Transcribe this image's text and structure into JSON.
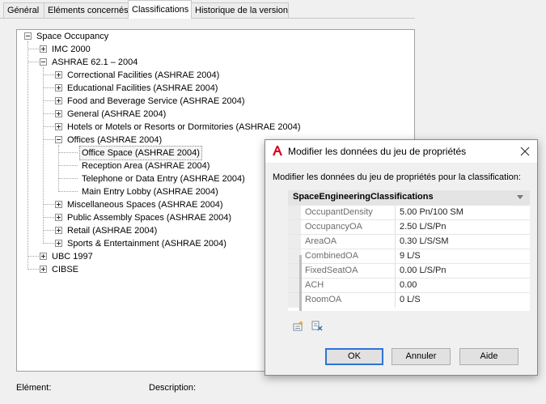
{
  "tabs": [
    {
      "label": "Général"
    },
    {
      "label": "Eléments concernés"
    },
    {
      "label": "Classifications"
    },
    {
      "label": "Historique de la version"
    }
  ],
  "tree": {
    "root": "Space Occupancy",
    "imc": "IMC 2000",
    "ashrae": "ASHRAE 62.1 – 2004",
    "correctional": "Correctional Facilities (ASHRAE 2004)",
    "educational": "Educational Facilities (ASHRAE 2004)",
    "food": "Food and Beverage Service (ASHRAE 2004)",
    "general": "General (ASHRAE 2004)",
    "hotels": "Hotels or Motels or Resorts or Dormitories (ASHRAE 2004)",
    "offices": "Offices (ASHRAE 2004)",
    "office_space": "Office Space (ASHRAE 2004)",
    "reception": "Reception Area (ASHRAE 2004)",
    "telephone": "Telephone or Data Entry (ASHRAE 2004)",
    "lobby": "Main Entry Lobby (ASHRAE 2004)",
    "misc": "Miscellaneous Spaces (ASHRAE 2004)",
    "public": "Public Assembly Spaces (ASHRAE 2004)",
    "retail": "Retail (ASHRAE 2004)",
    "sports": "Sports & Entertainment (ASHRAE 2004)",
    "ubc": "UBC 1997",
    "cibse": "CIBSE"
  },
  "bottom": {
    "element_label": "Elément:",
    "description_label": "Description:"
  },
  "dialog": {
    "title": "Modifier les données du jeu de propriétés",
    "subtitle": "Modifier les données du jeu de propriétés pour la classification:",
    "group_name": "SpaceEngineeringClassifications",
    "properties": [
      {
        "name": "OccupantDensity",
        "value": "5.00 Pn/100 SM"
      },
      {
        "name": "OccupancyOA",
        "value": "2.50  L/S/Pn"
      },
      {
        "name": "AreaOA",
        "value": "0.30 L/S/SM"
      },
      {
        "name": "CombinedOA",
        "value": "9 L/S"
      },
      {
        "name": "FixedSeatOA",
        "value": "0.00  L/S/Pn"
      },
      {
        "name": "ACH",
        "value": "0.00"
      },
      {
        "name": "RoomOA",
        "value": "0 L/S"
      }
    ],
    "ok_label": "OK",
    "cancel_label": "Annuler",
    "help_label": "Aide",
    "icon_color": "#d6001c",
    "accent_color": "#2d73d6"
  }
}
